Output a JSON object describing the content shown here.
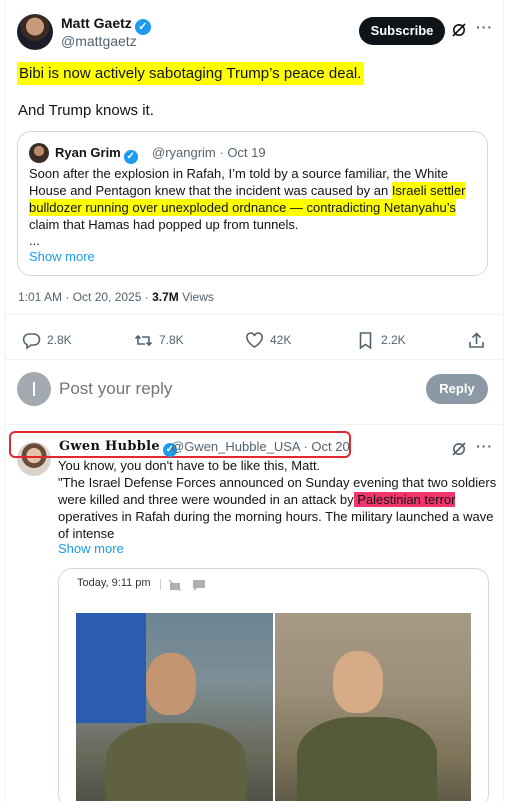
{
  "main_tweet": {
    "author_name": "Matt Gaetz",
    "author_handle": "@mattgaetz",
    "subscribe_label": "Subscribe",
    "text_line1": "Bibi is now actively sabotaging Trump’s peace deal.",
    "text_line2": "And Trump knows it.",
    "timestamp": "1:01 AM · Oct 20, 2025 · ",
    "views_count": "3.7M",
    "views_label": " Views",
    "replies": "2.8K",
    "reposts": "7.8K",
    "likes": "42K",
    "bookmarks": "2.2K"
  },
  "quoted_tweet": {
    "author_name": "Ryan Grim",
    "author_handle": "@ryangrim · Oct 19",
    "text_part1": "Soon after the explosion in Rafah, I’m told by a source familiar, the White House and Pentagon knew that the incident was caused by an ",
    "text_highlight": "Israeli settler bulldozer running over unexploded ordnance — contradicting  Netanyahu’s",
    "text_part2": " claim that Hamas had popped up from tunnels.",
    "ellipsis": "...",
    "show_more": "Show more"
  },
  "compose": {
    "placeholder": "Post your reply",
    "reply_button": "Reply"
  },
  "reply_tweet": {
    "author_name": "Gwen Hubble",
    "author_handle": "@Gwen_Hubble_USA · Oct 20",
    "text_line1": "You know, you don't have to be like this, Matt.",
    "text_part1": "\"The Israel Defense Forces announced on Sunday evening that two soldiers were killed and three were wounded in an attack by",
    "text_highlight": " Palestinian terror ",
    "text_part2": "operatives in Rafah during the morning hours. The military launched a wave of intense",
    "show_more": "Show more",
    "card_time": "Today, 9:11 pm"
  },
  "colors": {
    "accent": "#1d9bf0",
    "highlight_yellow": "#ffff00",
    "highlight_pink": "#f5346e",
    "annotation_red": "#e0282e"
  }
}
